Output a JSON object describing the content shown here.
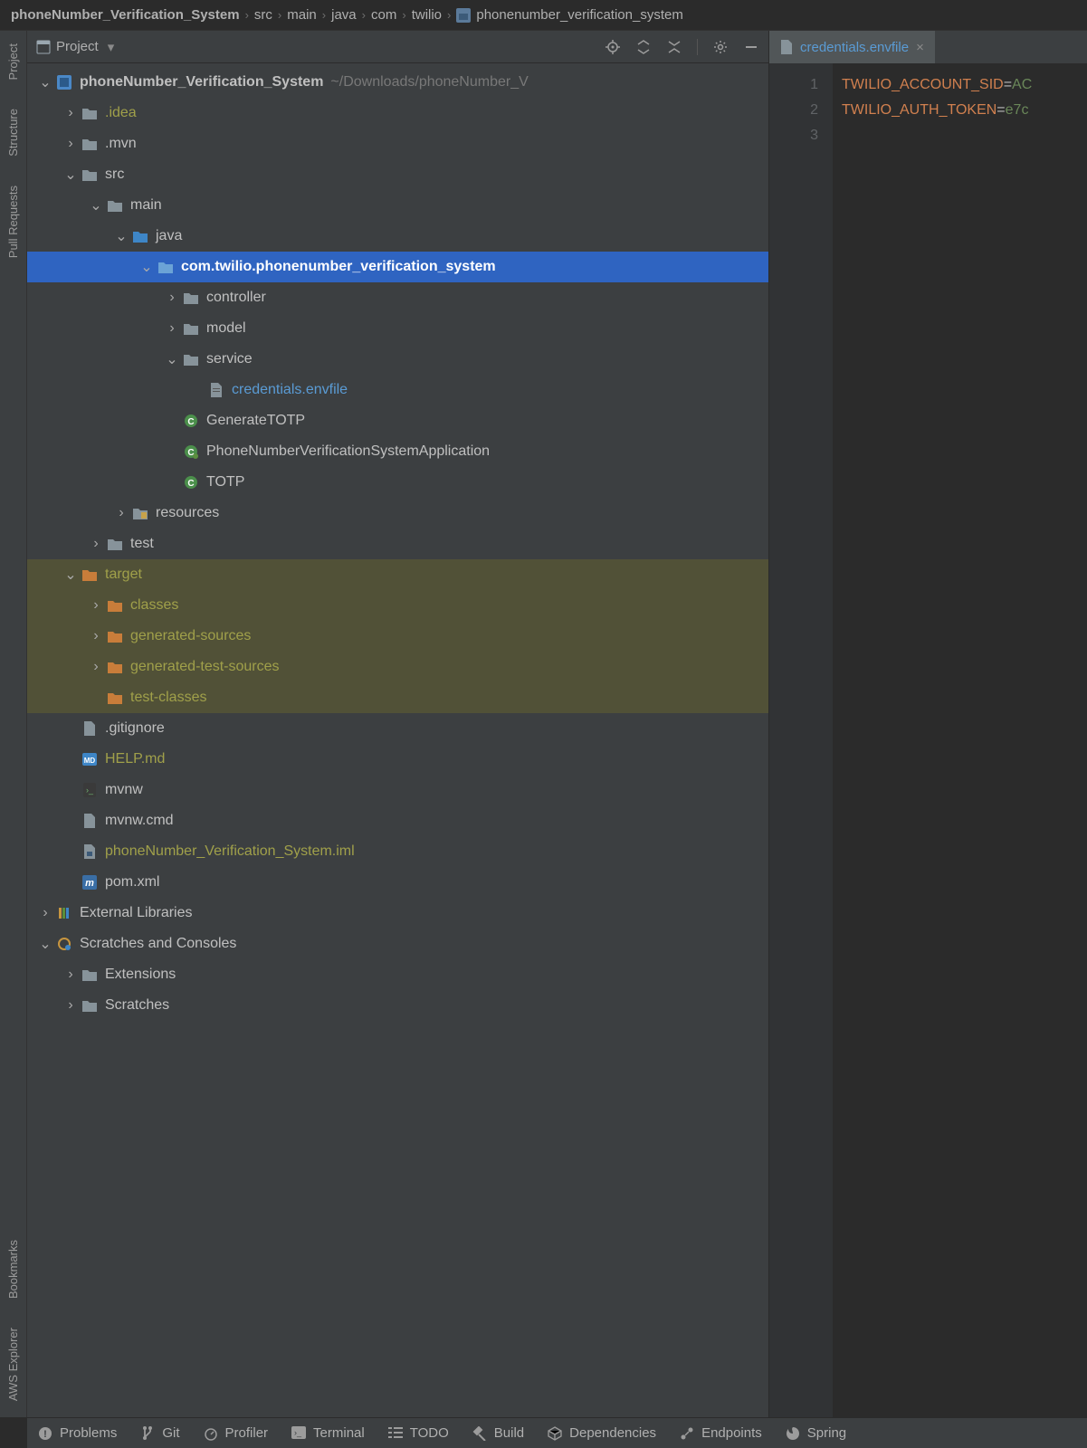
{
  "breadcrumbs": [
    "phoneNumber_Verification_System",
    "src",
    "main",
    "java",
    "com",
    "twilio",
    "phonenumber_verification_system"
  ],
  "panel": {
    "title": "Project"
  },
  "root": {
    "name": "phoneNumber_Verification_System",
    "path": "~/Downloads/phoneNumber_V"
  },
  "tree": {
    "idea": ".idea",
    "mvn": ".mvn",
    "src": "src",
    "main": "main",
    "java": "java",
    "pkg": "com.twilio.phonenumber_verification_system",
    "controller": "controller",
    "model": "model",
    "service": "service",
    "credentials": "credentials.envfile",
    "gen_totp": "GenerateTOTP",
    "app": "PhoneNumberVerificationSystemApplication",
    "totp": "TOTP",
    "resources": "resources",
    "test": "test",
    "target": "target",
    "classes": "classes",
    "gensources": "generated-sources",
    "gentestsrc": "generated-test-sources",
    "testclasses": "test-classes",
    "gitignore": ".gitignore",
    "help": "HELP.md",
    "mvnw": "mvnw",
    "mvnwcmd": "mvnw.cmd",
    "iml": "phoneNumber_Verification_System.iml",
    "pom": "pom.xml",
    "extlibs": "External Libraries",
    "scratches": "Scratches and Consoles",
    "extensions": "Extensions",
    "scratchesf": "Scratches"
  },
  "left_tools": {
    "project": "Project",
    "structure": "Structure",
    "pull": "Pull Requests",
    "bookmarks": "Bookmarks",
    "aws": "AWS Explorer"
  },
  "tabs": {
    "t0": "credentials.envfile"
  },
  "editor": {
    "lines": [
      "1",
      "2",
      "3"
    ],
    "l1_key": "TWILIO_ACCOUNT_SID",
    "l1_val": "AC",
    "l2_key": "TWILIO_AUTH_TOKEN",
    "l2_val": "e7c"
  },
  "bottom": {
    "problems": "Problems",
    "git": "Git",
    "profiler": "Profiler",
    "terminal": "Terminal",
    "todo": "TODO",
    "build": "Build",
    "deps": "Dependencies",
    "endpoints": "Endpoints",
    "spring": "Spring"
  }
}
